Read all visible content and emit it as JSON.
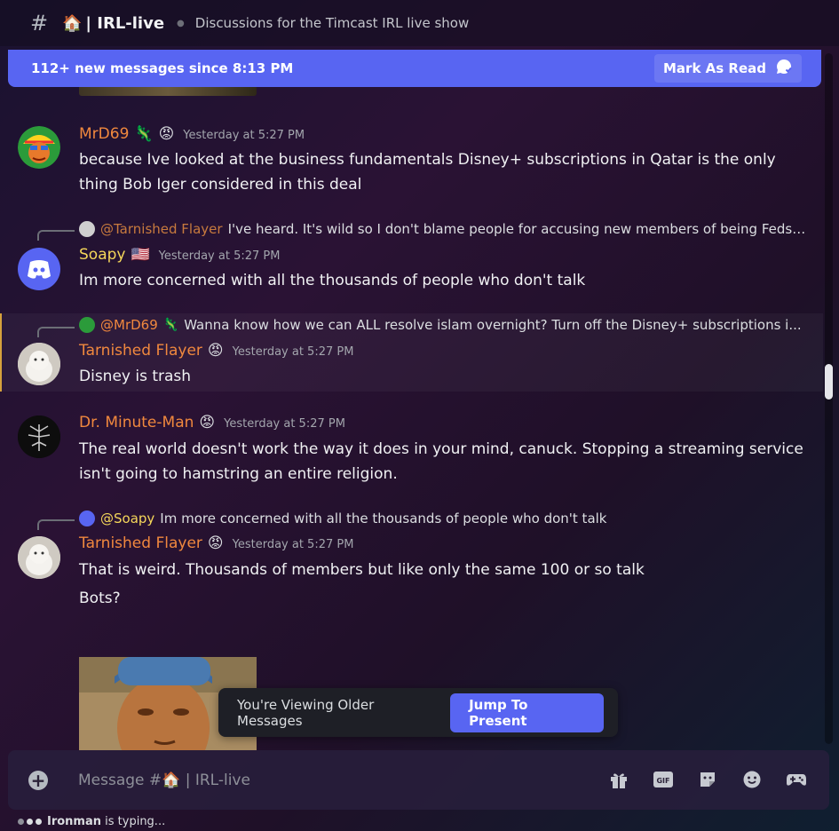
{
  "header": {
    "channel_prefix": "#",
    "channel_emoji": "🏠",
    "channel_name": "| IRL-live",
    "topic": "Discussions for the Timcast IRL live show"
  },
  "new_messages_bar": {
    "text": "112+ new messages since 8:13 PM",
    "mark_as_read": "Mark As Read"
  },
  "messages": [
    {
      "author": "MrD69",
      "author_color": "#f0883e",
      "badges": [
        "🦎",
        "😡"
      ],
      "timestamp": "Yesterday at 5:27 PM",
      "body": "because Ive looked at the business fundamentals Disney+ subscriptions in Qatar is the only thing Bob Iger considered in this deal"
    },
    {
      "reply_to": "@Tarnished Flayer",
      "reply_text": "I've heard. It's wild so I don't blame people for accusing new members of being Feds. ...",
      "author": "Soapy",
      "author_color": "#f5d75a",
      "badges": [
        "🇺🇸"
      ],
      "timestamp": "Yesterday at 5:27 PM",
      "body": "Im more concerned with all the thousands of people who don't talk"
    },
    {
      "reply_to": "@MrD69",
      "reply_badge": "🦎",
      "reply_text": "Wanna know how we can ALL resolve islam overnight? Turn off the Disney+ subscriptions i...",
      "author": "Tarnished Flayer",
      "author_color": "#f0883e",
      "badges": [
        "😡"
      ],
      "timestamp": "Yesterday at 5:27 PM",
      "body": "Disney is trash"
    },
    {
      "author": "Dr. Minute-Man",
      "author_color": "#f0883e",
      "badges": [
        "😡"
      ],
      "timestamp": "Yesterday at 5:27 PM",
      "body": "The real world doesn't work the way it does in your mind, canuck. Stopping a streaming service isn't going to hamstring an entire religion."
    },
    {
      "reply_to": "@Soapy",
      "reply_text": "Im more concerned with all the thousands of people who don't talk",
      "author": "Tarnished Flayer",
      "author_color": "#f0883e",
      "badges": [
        "😡"
      ],
      "timestamp": "Yesterday at 5:27 PM",
      "body": "That is weird. Thousands of members but like only the same 100 or so talk",
      "body2": "Bots?"
    }
  ],
  "older_messages": {
    "text": "You're Viewing Older Messages",
    "jump": "Jump To Present"
  },
  "composer": {
    "placeholder": "Message #🏠 | IRL-live",
    "icons": [
      "gift-icon",
      "gif-icon",
      "sticker-icon",
      "emoji-icon",
      "gamepad-icon"
    ],
    "gif_label": "GIF"
  },
  "typing": {
    "user": "Ironman",
    "suffix": " is typing..."
  },
  "colors": {
    "accent": "#5865f2",
    "orange_name": "#f0883e",
    "yellow_name": "#f5d75a",
    "mention_orange": "#f0883e"
  }
}
